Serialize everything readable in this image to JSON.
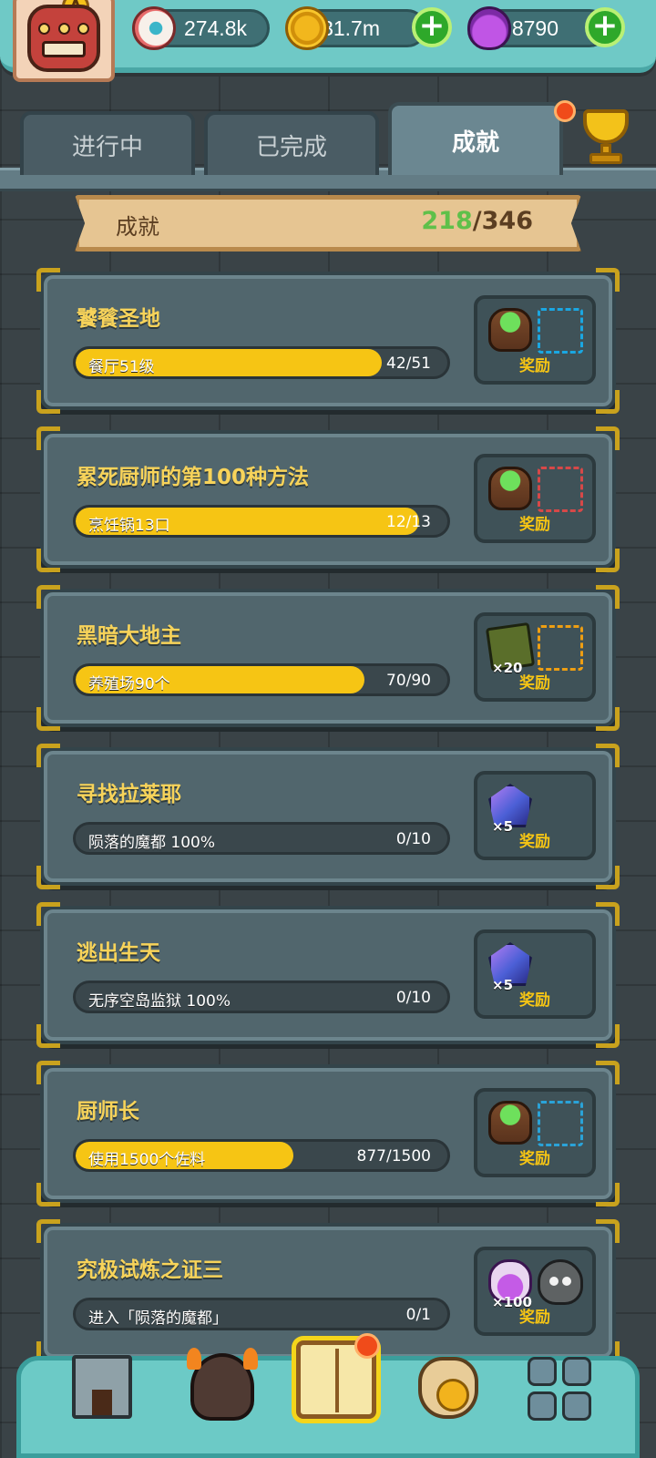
{
  "currencies": {
    "eyes": {
      "value": "274.8k",
      "icon": "eyeball-icon"
    },
    "gold": {
      "value": "31.7m",
      "icon": "gold-coin-icon"
    },
    "potion": {
      "value": "8790",
      "icon": "purple-potion-icon"
    }
  },
  "player": {
    "rank_letter": "A"
  },
  "tabs": [
    {
      "label": "进行中"
    },
    {
      "label": "已完成"
    },
    {
      "label": "成就"
    }
  ],
  "header": {
    "title": "成就",
    "completed": "218",
    "separator": "/",
    "total": "346"
  },
  "reward_label": "奖励",
  "achievements": [
    {
      "title": "饕餮圣地",
      "task": "餐厅51级",
      "progress": "42/51",
      "fraction": 0.8235,
      "reward_item": "cabbage-crate-icon",
      "reward_qty": "",
      "slot_color": "#1aa7e2"
    },
    {
      "title": "累死厨师的第100种方法",
      "task": "烹饪锅13口",
      "progress": "12/13",
      "fraction": 0.923,
      "reward_item": "cabbage-crate-icon",
      "reward_qty": "",
      "slot_color": "#d74848"
    },
    {
      "title": "黑暗大地主",
      "task": "养殖场90个",
      "progress": "70/90",
      "fraction": 0.7778,
      "reward_item": "treasure-map-icon",
      "reward_qty": "×20",
      "slot_color": "#ee9e12"
    },
    {
      "title": "寻找拉莱耶",
      "task": "陨落的魔都 100%",
      "progress": "0/10",
      "fraction": 0,
      "reward_item": "crystal-icon",
      "reward_qty": "×5",
      "slot_color": ""
    },
    {
      "title": "逃出生天",
      "task": "无序空岛监狱 100%",
      "progress": "0/10",
      "fraction": 0,
      "reward_item": "crystal-icon",
      "reward_qty": "×5",
      "slot_color": ""
    },
    {
      "title": "厨师长",
      "task": "使用1500个佐料",
      "progress": "877/1500",
      "fraction": 0.5847,
      "reward_item": "cabbage-crate-icon",
      "reward_qty": "",
      "slot_color": "#2aa3d8"
    },
    {
      "title": "究极试炼之证三",
      "task": "进入「陨落的魔都」",
      "progress": "0/1",
      "fraction": 0,
      "reward_item": "purple-potion-icon",
      "reward_qty": "×100",
      "slot_color": "",
      "extra_item": "horned-monster-icon"
    }
  ],
  "colors": {
    "accent_yellow": "#f6c514",
    "title_gold": "#f7d35a",
    "completed_green": "#5fc04a",
    "teal": "#6ccac6"
  }
}
